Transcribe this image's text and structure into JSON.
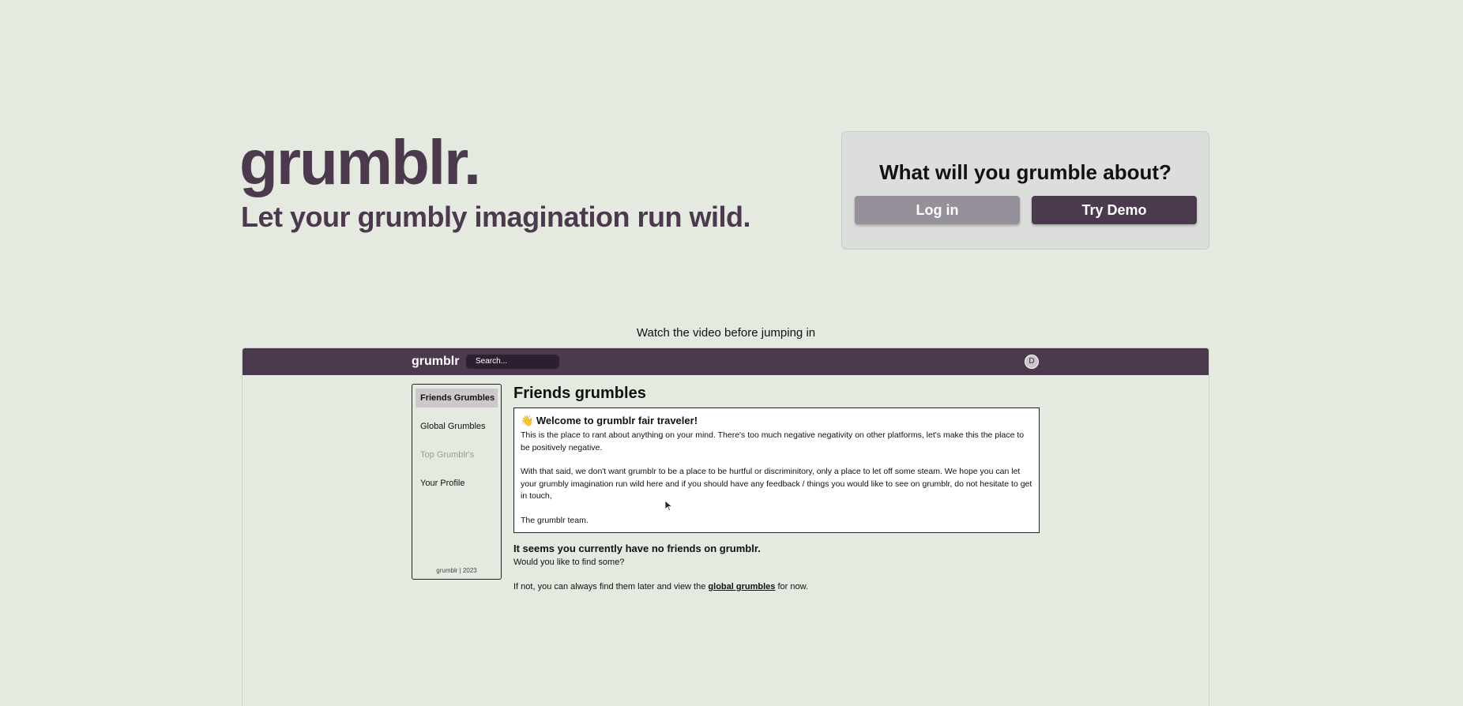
{
  "hero": {
    "title": "grumblr.",
    "subtitle": "Let your grumbly imagination run wild."
  },
  "cta": {
    "title": "What will you grumble about?",
    "login_label": "Log in",
    "demo_label": "Try Demo"
  },
  "video": {
    "caption": "Watch the video before jumping in",
    "app": {
      "logo": "grumblr",
      "search_placeholder": "Search...",
      "avatar_initial": "D",
      "sidebar": {
        "items": [
          {
            "label": "Friends Grumbles"
          },
          {
            "label": "Global Grumbles"
          },
          {
            "label": "Top Grumblr's"
          },
          {
            "label": "Your Profile"
          }
        ],
        "footer": "grumblr | 2023"
      },
      "feed_title": "Friends grumbles",
      "welcome": {
        "emoji": "👋",
        "heading": "Welcome to grumblr fair traveler!",
        "p1": "This is the place to rant about anything on your mind. There's too much negative negativity on other platforms, let's make this the place to be positively negative.",
        "p2": "With that said, we don't want grumblr to be a place to be hurtful or discriminitory, only a place to let off some steam. We hope you can let your grumbly imagination run wild here and if you should have any feedback / things you would like to see on grumblr, do not hesitate to get in touch,",
        "p3": "The grumblr team."
      },
      "no_friends": {
        "heading": "It seems you currently have no friends on grumblr.",
        "question": "Would you like to find some?",
        "fallback_prefix": "If not, you can always find them later and view the ",
        "fallback_link": "global grumbles",
        "fallback_suffix": " for now."
      }
    }
  },
  "colors": {
    "background": "#e5eae1",
    "brand": "#4b3a4e",
    "login_button": "#95909a"
  }
}
